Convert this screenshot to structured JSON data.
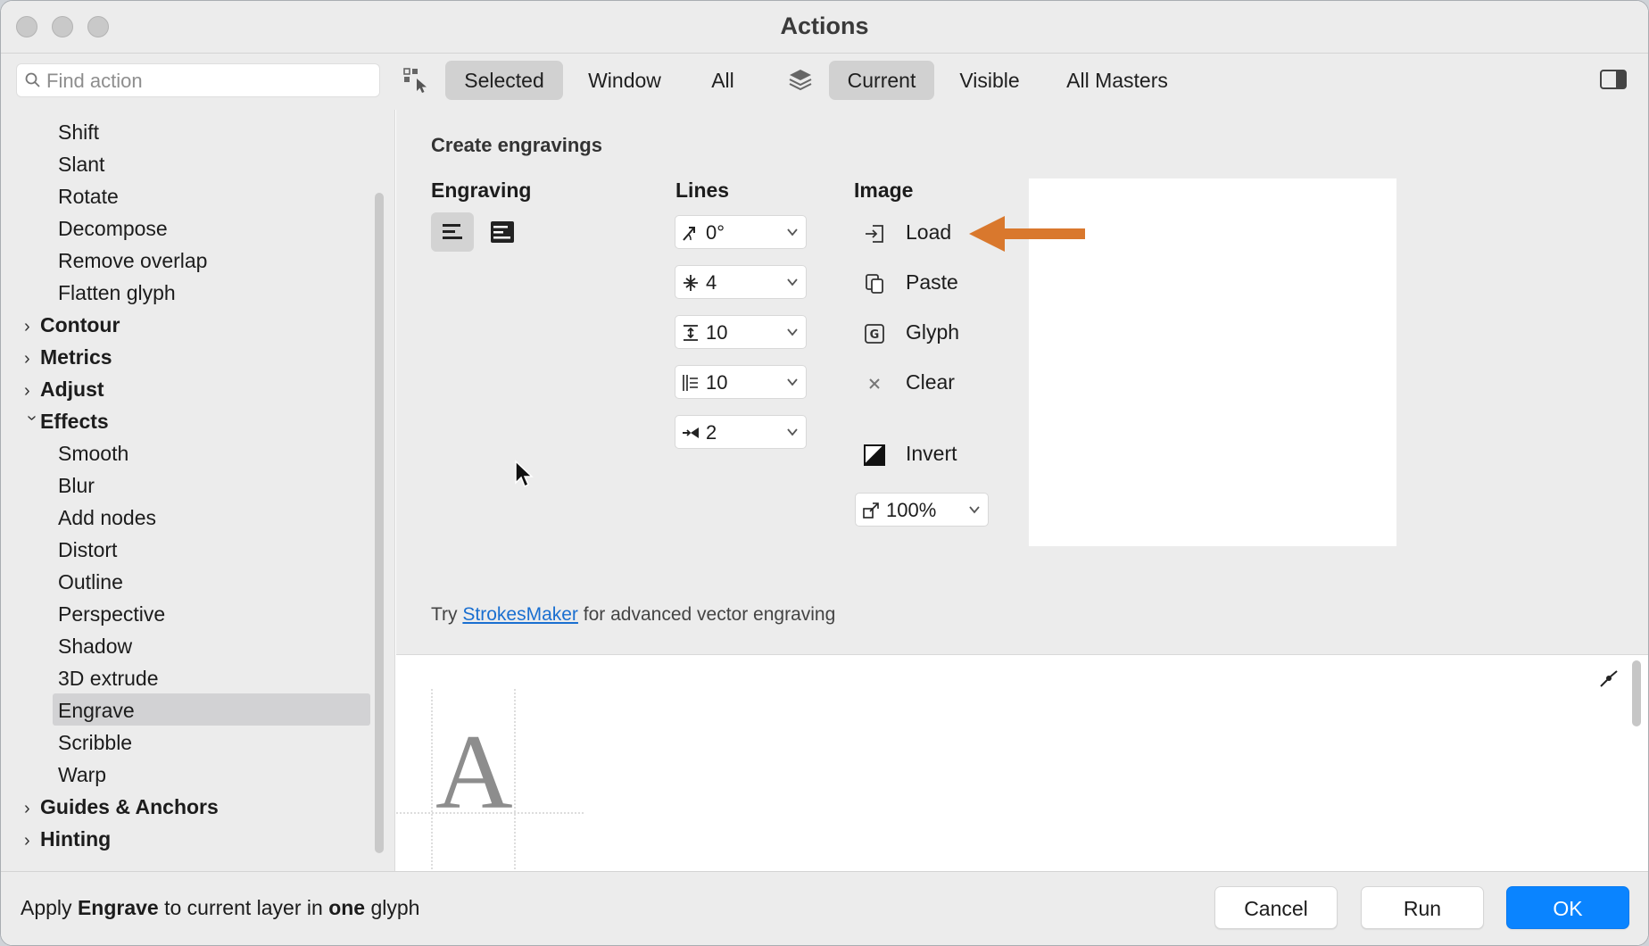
{
  "window": {
    "title": "Actions"
  },
  "toolbar": {
    "search_placeholder": "Find action",
    "scope": [
      "Selected",
      "Window",
      "All"
    ],
    "layers": [
      "Current",
      "Visible",
      "All Masters"
    ]
  },
  "sidebar": {
    "items": [
      {
        "label": "Shift",
        "kind": "child"
      },
      {
        "label": "Slant",
        "kind": "child"
      },
      {
        "label": "Rotate",
        "kind": "child"
      },
      {
        "label": "Decompose",
        "kind": "child"
      },
      {
        "label": "Remove overlap",
        "kind": "child"
      },
      {
        "label": "Flatten glyph",
        "kind": "child"
      },
      {
        "label": "Contour",
        "kind": "group",
        "expanded": false
      },
      {
        "label": "Metrics",
        "kind": "group",
        "expanded": false
      },
      {
        "label": "Adjust",
        "kind": "group",
        "expanded": false
      },
      {
        "label": "Effects",
        "kind": "group",
        "expanded": true
      },
      {
        "label": "Smooth",
        "kind": "child"
      },
      {
        "label": "Blur",
        "kind": "child"
      },
      {
        "label": "Add nodes",
        "kind": "child"
      },
      {
        "label": "Distort",
        "kind": "child"
      },
      {
        "label": "Outline",
        "kind": "child"
      },
      {
        "label": "Perspective",
        "kind": "child"
      },
      {
        "label": "Shadow",
        "kind": "child"
      },
      {
        "label": "3D extrude",
        "kind": "child"
      },
      {
        "label": "Engrave",
        "kind": "child",
        "selected": true
      },
      {
        "label": "Scribble",
        "kind": "child"
      },
      {
        "label": "Warp",
        "kind": "child"
      },
      {
        "label": "Guides & Anchors",
        "kind": "group",
        "expanded": false
      },
      {
        "label": "Hinting",
        "kind": "group",
        "expanded": false
      }
    ]
  },
  "panel": {
    "title": "Create engravings",
    "engraving_label": "Engraving",
    "lines_label": "Lines",
    "image_label": "Image",
    "lines": [
      {
        "icon": "angle-icon",
        "value": "0°"
      },
      {
        "icon": "line-count-icon",
        "value": "4"
      },
      {
        "icon": "spacing-icon",
        "value": "10"
      },
      {
        "icon": "width-icon",
        "value": "10"
      },
      {
        "icon": "taper-icon",
        "value": "2"
      }
    ],
    "image_actions": [
      "Load",
      "Paste",
      "Glyph",
      "Clear"
    ],
    "invert_label": "Invert",
    "scale_value": "100%",
    "tip_before": "Try",
    "tip_link": "StrokesMaker",
    "tip_after": "for advanced vector engraving"
  },
  "preview": {
    "glyph": "A"
  },
  "footer": {
    "status_1": "Apply",
    "status_action": "Engrave",
    "status_2": "to current layer in",
    "status_count": "one",
    "status_3": "glyph",
    "cancel": "Cancel",
    "run": "Run",
    "ok": "OK"
  },
  "colors": {
    "accent": "#0a84ff",
    "arrow": "#d9782d",
    "link": "#1a6fd0"
  }
}
